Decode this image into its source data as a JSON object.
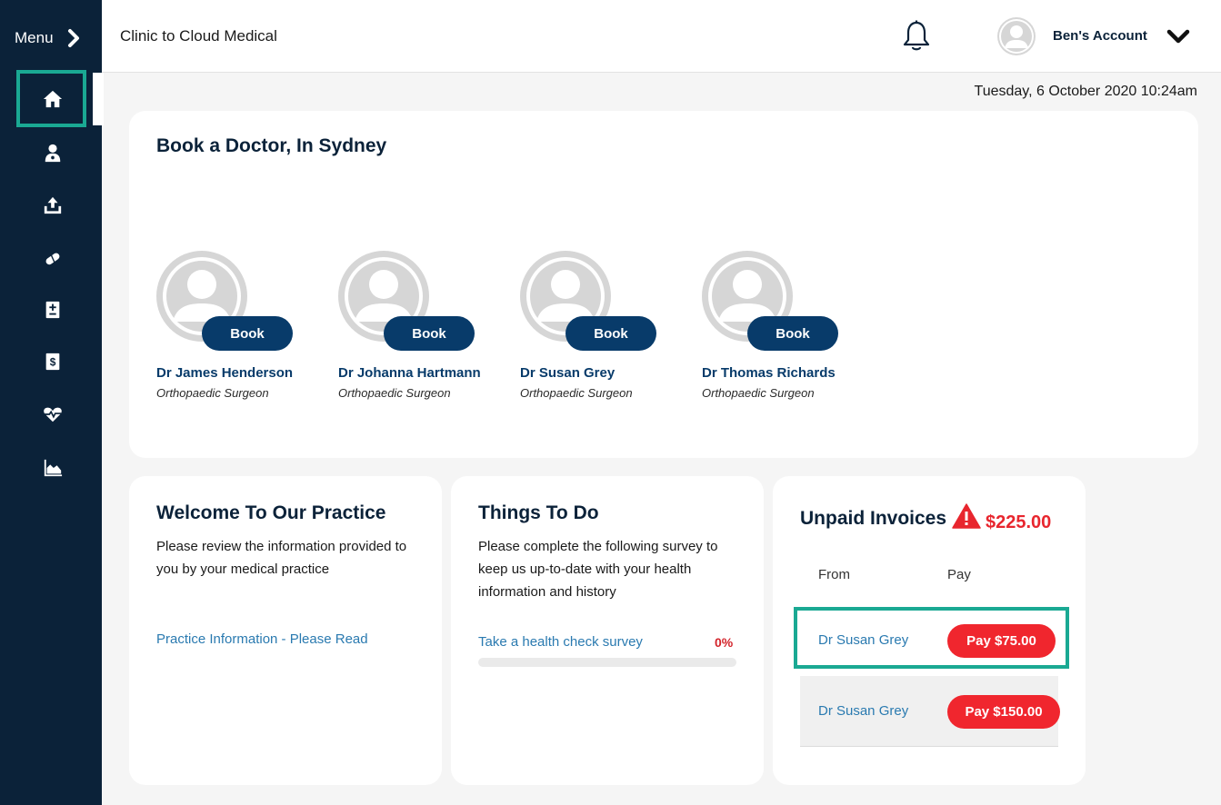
{
  "sidebar": {
    "menu_label": "Menu",
    "items": [
      {
        "icon": "home-icon",
        "active": true
      },
      {
        "icon": "doctor-icon"
      },
      {
        "icon": "upload-icon"
      },
      {
        "icon": "pills-icon"
      },
      {
        "icon": "medical-record-icon"
      },
      {
        "icon": "invoice-dollar-icon"
      },
      {
        "icon": "heartbeat-icon"
      },
      {
        "icon": "area-chart-icon"
      }
    ]
  },
  "header": {
    "app_title": "Clinic to Cloud Medical",
    "account_name": "Ben's Account"
  },
  "datetime": "Tuesday, 6 October 2020 10:24am",
  "book_doctor": {
    "title": "Book a Doctor, In Sydney",
    "doctors": [
      {
        "name": "Dr James Henderson",
        "specialty": "Orthopaedic Surgeon",
        "button": "Book"
      },
      {
        "name": "Dr Johanna Hartmann",
        "specialty": "Orthopaedic Surgeon",
        "button": "Book"
      },
      {
        "name": "Dr Susan Grey",
        "specialty": "Orthopaedic Surgeon",
        "button": "Book"
      },
      {
        "name": "Dr Thomas Richards",
        "specialty": "Orthopaedic Surgeon",
        "button": "Book"
      }
    ]
  },
  "welcome": {
    "title": "Welcome To Our Practice",
    "body": "Please review the information provided to you by your medical practice",
    "link": "Practice Information - Please Read"
  },
  "todo": {
    "title": "Things To Do",
    "body": "Please complete the following survey to keep us up-to-date with your health information and history",
    "task_link": "Take a health check survey",
    "progress_label": "0%",
    "progress_value": 0
  },
  "invoices": {
    "title": "Unpaid Invoices",
    "total": "$225.00",
    "col_from": "From",
    "col_pay": "Pay",
    "rows": [
      {
        "from": "Dr Susan Grey",
        "pay": "Pay $75.00"
      },
      {
        "from": "Dr Susan Grey",
        "pay": "Pay $150.00"
      }
    ]
  },
  "colors": {
    "sidebar_bg": "#0b2239",
    "highlight": "#1aa993",
    "book_button": "#083b6a",
    "pay_button": "#f0262e",
    "alert": "#e8262e",
    "link": "#2a7ab0"
  }
}
